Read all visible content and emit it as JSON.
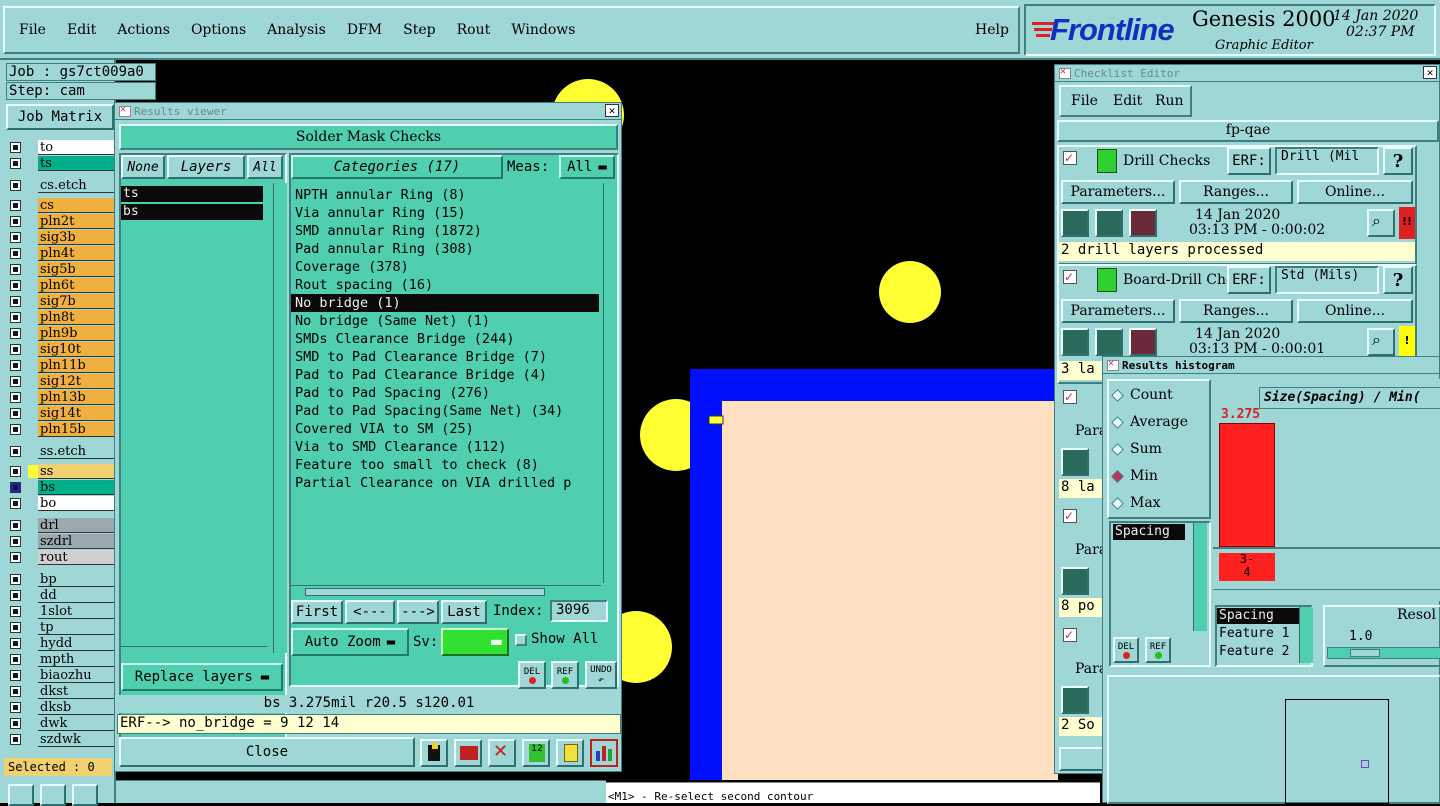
{
  "menubar": {
    "items": [
      "File",
      "Edit",
      "Actions",
      "Options",
      "Analysis",
      "DFM",
      "Step",
      "Rout",
      "Windows"
    ],
    "help": "Help",
    "brand": "Frontline",
    "product": "Genesis 2000",
    "subtitle": "Graphic Editor",
    "date": "14 Jan 2020",
    "time": "02:37 PM"
  },
  "job": {
    "job_label": "Job : gs7ct009a0",
    "step_label": "Step: cam",
    "matrix_button": "Job Matrix",
    "selected": "Selected : 0"
  },
  "layers": [
    {
      "name": "to",
      "color": "#ffffff"
    },
    {
      "name": "ts",
      "color": "#00b08a"
    },
    {
      "name": "cs.etch",
      "color": "#9fd6d6"
    },
    {
      "name": "cs",
      "color": "#f0b040"
    },
    {
      "name": "pln2t",
      "color": "#f0b040"
    },
    {
      "name": "sig3b",
      "color": "#f0b040"
    },
    {
      "name": "pln4t",
      "color": "#f0b040"
    },
    {
      "name": "sig5b",
      "color": "#f0b040"
    },
    {
      "name": "pln6t",
      "color": "#f0b040"
    },
    {
      "name": "sig7b",
      "color": "#f0b040"
    },
    {
      "name": "pln8t",
      "color": "#f0b040"
    },
    {
      "name": "pln9b",
      "color": "#f0b040"
    },
    {
      "name": "sig10t",
      "color": "#f0b040"
    },
    {
      "name": "pln11b",
      "color": "#f0b040"
    },
    {
      "name": "sig12t",
      "color": "#f0b040"
    },
    {
      "name": "pln13b",
      "color": "#f0b040"
    },
    {
      "name": "sig14t",
      "color": "#f0b040"
    },
    {
      "name": "pln15b",
      "color": "#f0b040"
    },
    {
      "name": "ss.etch",
      "color": "#9fd6d6"
    },
    {
      "name": "ss",
      "color": "#f0d070"
    },
    {
      "name": "bs",
      "color": "#00b08a"
    },
    {
      "name": "bo",
      "color": "#ffffff"
    },
    {
      "name": "drl",
      "color": "#9aa8b0"
    },
    {
      "name": "szdrl",
      "color": "#9aa8b0"
    },
    {
      "name": "rout",
      "color": "#d0d0d0"
    },
    {
      "name": "bp",
      "color": "#9fd6d6"
    },
    {
      "name": "dd",
      "color": "#9fd6d6"
    },
    {
      "name": "1slot",
      "color": "#9fd6d6"
    },
    {
      "name": "tp",
      "color": "#9fd6d6"
    },
    {
      "name": "hydd",
      "color": "#9fd6d6"
    },
    {
      "name": "mpth",
      "color": "#9fd6d6"
    },
    {
      "name": "biaozhu",
      "color": "#9fd6d6"
    },
    {
      "name": "dkst",
      "color": "#9fd6d6"
    },
    {
      "name": "dksb",
      "color": "#9fd6d6"
    },
    {
      "name": "dwk",
      "color": "#9fd6d6"
    },
    {
      "name": "szdwk",
      "color": "#9fd6d6"
    }
  ],
  "results_viewer": {
    "title": "Results viewer",
    "header": "Solder Mask Checks",
    "none_btn": "None",
    "layers_btn": "Layers",
    "all_btn": "All",
    "layer_list": [
      "ts",
      "bs"
    ],
    "categories_btn": "Categories (17)",
    "meas_label": "Meas:",
    "meas_value": "All",
    "categories": [
      "NPTH annular Ring (8)",
      "Via annular Ring (15)",
      "SMD annular Ring (1872)",
      "Pad annular Ring (308)",
      "Coverage (378)",
      "Rout spacing (16)",
      "No bridge (1)",
      "No bridge (Same Net) (1)",
      "SMDs Clearance Bridge (244)",
      "SMD to Pad Clearance Bridge (7)",
      "Pad to Pad Clearance Bridge (4)",
      "Pad to Pad Spacing (276)",
      "Pad to Pad Spacing(Same Net) (34)",
      "Covered VIA to SM (25)",
      "Via to SMD Clearance (112)",
      "Feature too small to check (8)",
      "Partial Clearance on VIA drilled p"
    ],
    "selected_index": 6,
    "first_btn": "First",
    "prev_btn": "<---",
    "next_btn": "--->",
    "last_btn": "Last",
    "index_label": "Index:",
    "index_value": "3096",
    "replace_btn": "Replace layers",
    "autozoom_btn": "Auto Zoom",
    "sv_label": "Sv:",
    "show_all_label": "Show All",
    "del_label": "DEL",
    "ref_label": "REF",
    "undo_label": "UNDO",
    "status": "bs 3.275mil  r20.5  s120.01",
    "erf_line": "ERF--> no_bridge = 9 12 14",
    "close_btn": "Close"
  },
  "checklist_editor": {
    "title": "Checklist Editor",
    "menu": [
      "File",
      "Edit",
      "Run"
    ],
    "checklist_name": "fp-qae",
    "checks": [
      {
        "name": "Drill Checks",
        "erf": "Drill (Mil",
        "date": "14 Jan 2020",
        "time": "03:13 PM - 0:00:02",
        "message": "2 drill layers processed",
        "status_color": "#e02020",
        "status_mark": "!!"
      },
      {
        "name": "Board-Drill Che",
        "erf": "Std (Mils)",
        "date": "14 Jan 2020",
        "time": "03:13 PM - 0:00:01",
        "message": "3 la",
        "status_color": "#ffff00",
        "status_mark": "!"
      }
    ],
    "erf_label": "ERF:",
    "help_mark": "?",
    "params_btn": "Parameters...",
    "ranges_btn": "Ranges...",
    "online_btn": "Online...",
    "partial_rows": [
      "8 la",
      "8 po",
      "2 So"
    ],
    "partial_btn": "Para"
  },
  "histogram": {
    "title": "Results histogram",
    "modes": [
      "Count",
      "Average",
      "Sum",
      "Min",
      "Max"
    ],
    "selected_mode": "Min",
    "axis_title": "Size(Spacing) / Min(",
    "list_items": [
      "Spacing"
    ],
    "bar_value": "3.275",
    "bar_fraction": 1.0,
    "bin_label": "3-\n4",
    "measure_list": [
      "Spacing",
      "Feature 1",
      "Feature 2"
    ],
    "resolution_label": "Resol",
    "resolution_value": "1.0",
    "del_label": "DEL",
    "ref_label": "REF"
  },
  "statusbar": {
    "prompt": "<M1> - Re-select second contour"
  },
  "colors": {
    "panel": "#9fd6d6",
    "panel_dark": "#4fcfb0",
    "board_outline": "#0010ff",
    "board_fill": "#ffdfc2",
    "pad": "#ffff33",
    "bar": "#ff2020"
  }
}
